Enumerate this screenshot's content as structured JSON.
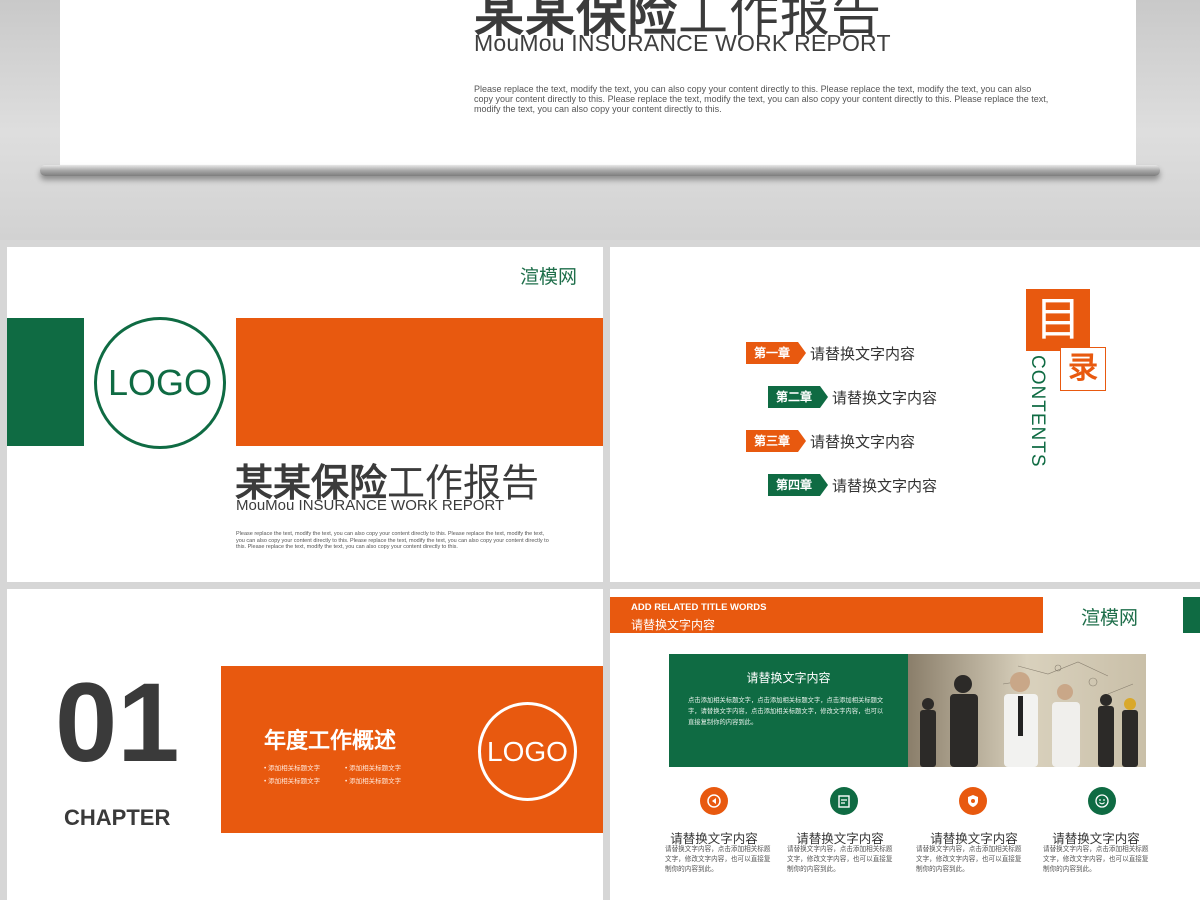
{
  "hero": {
    "title_bold": "某某保险",
    "title_light": "工作报告",
    "subtitle": "MouMou INSURANCE WORK REPORT",
    "body": "Please replace the text, modify the text, you can also copy your content directly to this. Please replace the text, modify the text, you can also copy your content directly to this. Please replace the text, modify the text, you can also copy your content directly to this. Please replace the text, modify the text, you can also copy your content directly to this."
  },
  "slide_cover": {
    "brand": "渲模网",
    "logo": "LOGO",
    "title_bold": "某某保险",
    "title_light": "工作报告",
    "subtitle": "MouMou INSURANCE WORK REPORT",
    "body": "Please replace the text, modify the text, you can also copy your content directly to this. Please replace the text, modify the text, you can also copy your content directly to this. Please replace the text, modify the text, you can also copy your content directly to this. Please replace the text, modify the text, you can also copy your content directly to this."
  },
  "slide_toc": {
    "title_1": "目",
    "title_2": "录",
    "contents": "CONTENTS",
    "items": [
      {
        "chapter": "第一章",
        "text": "请替换文字内容"
      },
      {
        "chapter": "第二章",
        "text": "请替换文字内容"
      },
      {
        "chapter": "第三章",
        "text": "请替换文字内容"
      },
      {
        "chapter": "第四章",
        "text": "请替换文字内容"
      }
    ]
  },
  "slide_chapter": {
    "number": "01",
    "chapter": "CHAPTER",
    "heading": "年度工作概述",
    "bullets": [
      "添加相关标题文字",
      "添加相关标题文字",
      "添加相关标题文字",
      "添加相关标题文字"
    ],
    "logo": "LOGO"
  },
  "slide_content": {
    "header_en": "ADD RELATED TITLE WORDS",
    "header_cn": "请替换文字内容",
    "brand": "渲模网",
    "panel_title": "请替换文字内容",
    "panel_body": "点击添加相关标题文字，点击添加相关标题文字，点击添加相关标题文字，请替换文字内容，点击添加相关标题文字，修改文字内容，也可以直接复制你的内容到此。",
    "features": [
      {
        "icon": "target-icon",
        "title": "请替换文字内容",
        "desc": "请替换文字内容，点击添加相关标题文字，修改文字内容，也可以直接复制你的内容到此。",
        "color": "#e8590f"
      },
      {
        "icon": "clipboard-icon",
        "title": "请替换文字内容",
        "desc": "请替换文字内容，点击添加相关标题文字，修改文字内容，也可以直接复制你的内容到此。",
        "color": "#0f6b43"
      },
      {
        "icon": "shield-icon",
        "title": "请替换文字内容",
        "desc": "请替换文字内容，点击添加相关标题文字，修改文字内容，也可以直接复制你的内容到此。",
        "color": "#e8590f"
      },
      {
        "icon": "smile-icon",
        "title": "请替换文字内容",
        "desc": "请替换文字内容，点击添加相关标题文字，修改文字内容，也可以直接复制你的内容到此。",
        "color": "#0f6b43"
      }
    ]
  },
  "colors": {
    "orange": "#e8590f",
    "green": "#0f6b43"
  }
}
